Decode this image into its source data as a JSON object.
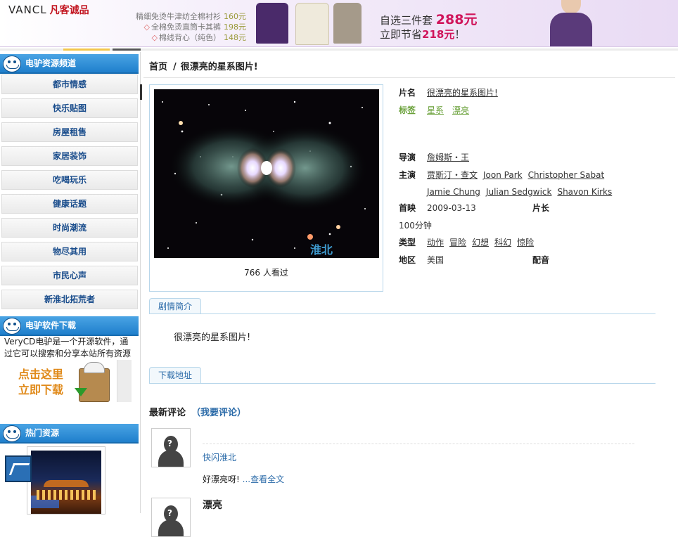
{
  "banner": {
    "logo": "VANCL",
    "logo_cn": "凡客诚品",
    "offers": [
      {
        "text": "精细免烫牛津纺全棉衬衫",
        "price": "160元"
      },
      {
        "text": "全棉免烫直筒卡其裤",
        "price": "198元"
      },
      {
        "text": "棉线背心（纯色）",
        "price": "148元"
      }
    ],
    "deal_line1": "自选三件套",
    "deal_price": "288元",
    "deal_line2_pre": "立即节省",
    "deal_save": "218元",
    "deal_line2_post": "！"
  },
  "sidebar": {
    "channel_title": "电驴资源频道",
    "channel_items": [
      "都市情感",
      "快乐贴图",
      "房屋租售",
      "家居装饰",
      "吃喝玩乐",
      "健康话题",
      "时尚潮流",
      "物尽其用",
      "市民心声",
      "新淮北拓荒者"
    ],
    "software_title": "电驴软件下载",
    "software_text": "VeryCD电驴是一个开源软件，通过它可以搜索和分享本站所有资源",
    "software_click_1": "点击这里",
    "software_click_2": "立即下载",
    "hot_title": "热门资源"
  },
  "breadcrumb": {
    "home": "首页",
    "sep": "/",
    "current": "很漂亮的星系图片!"
  },
  "poster": {
    "views": "766 人看过",
    "watermark": "淮北"
  },
  "info": {
    "name_label": "片名",
    "name": "很漂亮的星系图片!",
    "tags_label": "标签",
    "tags": [
      "星系",
      "漂亮"
    ],
    "director_label": "导演",
    "director": "詹姆斯・王",
    "cast_label": "主演",
    "cast_line1": [
      "贾斯汀・查文",
      "Joon Park",
      "Christopher Sabat"
    ],
    "cast_line2": [
      "Jamie Chung",
      "Julian Sedgwick",
      "Shavon Kirks"
    ],
    "release_label": "首映",
    "release": "2009-03-13",
    "length_label": "片长",
    "length": "100分钟",
    "genre_label": "类型",
    "genres": [
      "动作",
      "冒险",
      "幻想",
      "科幻",
      "惊险"
    ],
    "region_label": "地区",
    "region": "美国",
    "dub_label": "配音"
  },
  "tabs": {
    "synopsis": "剧情简介",
    "download": "下载地址"
  },
  "synopsis_text": "很漂亮的星系图片!",
  "comments": {
    "title": "最新评论",
    "post_link": "（我要评论）",
    "items": [
      {
        "user": "快闪淮北",
        "text": "好漂亮呀!",
        "more": "...查看全文"
      },
      {
        "user": "漂亮"
      }
    ]
  }
}
